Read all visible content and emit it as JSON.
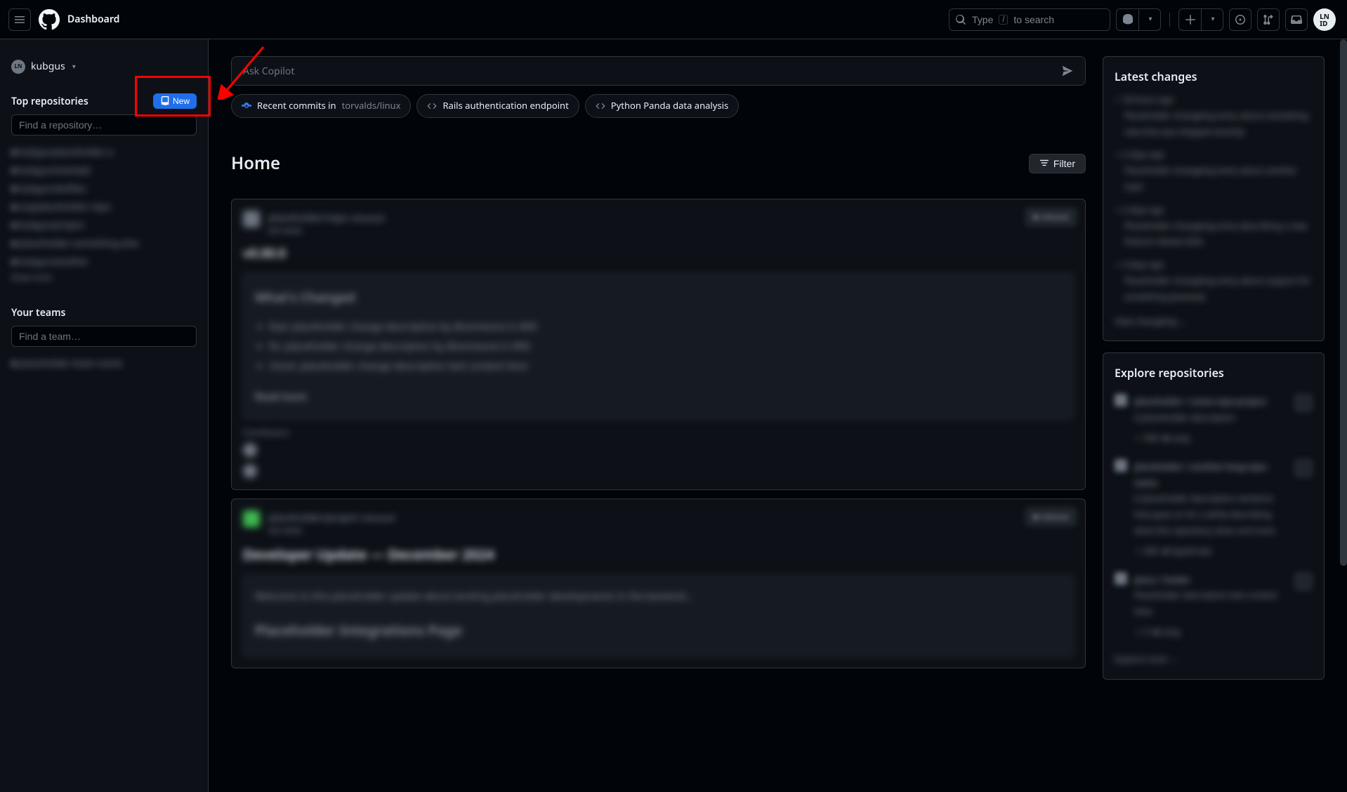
{
  "header": {
    "title": "Dashboard",
    "search_prefix": "Type",
    "search_key": "/",
    "search_suffix": "to search",
    "avatar_initials": "LN\\nID"
  },
  "sidebar": {
    "context_user": "kubgus",
    "top_repos_heading": "Top repositories",
    "new_btn": "New",
    "find_repo_placeholder": "Find a repository…",
    "your_teams_heading": "Your teams",
    "find_team_placeholder": "Find a team…"
  },
  "copilot": {
    "placeholder": "Ask Copilot"
  },
  "chips": {
    "recent_prefix": "Recent commits in",
    "recent_repo": "torvalds/linux",
    "rails": "Rails authentication endpoint",
    "panda": "Python Panda data analysis"
  },
  "home": {
    "title": "Home",
    "filter": "Filter"
  },
  "right": {
    "latest_title": "Latest changes",
    "explore_title": "Explore repositories"
  }
}
